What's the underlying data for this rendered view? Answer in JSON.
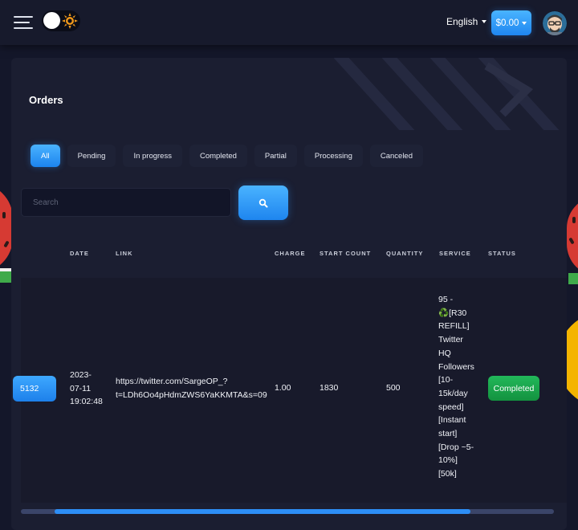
{
  "topbar": {
    "language": "English",
    "balance": "$0.00"
  },
  "page": {
    "title": "Orders"
  },
  "tabs": [
    {
      "label": "All",
      "active": true
    },
    {
      "label": "Pending",
      "active": false
    },
    {
      "label": "In progress",
      "active": false
    },
    {
      "label": "Completed",
      "active": false
    },
    {
      "label": "Partial",
      "active": false
    },
    {
      "label": "Processing",
      "active": false
    },
    {
      "label": "Canceled",
      "active": false
    }
  ],
  "search": {
    "placeholder": "Search",
    "value": ""
  },
  "table": {
    "headers": {
      "date": "DATE",
      "link": "LINK",
      "charge": "CHARGE",
      "start_count": "START COUNT",
      "quantity": "QUANTITY",
      "service": "SERVICE",
      "status": "STATUS"
    },
    "rows": [
      {
        "id": "5132",
        "date_line1": "2023-",
        "date_line2": "07-11",
        "date_line3": "19:02:48",
        "link_line1": "https://twitter.com/SargeOP_?",
        "link_line2": "t=LDh6Oo4pHdmZWS6YaKKMTA&s=09",
        "charge": "1.00",
        "start_count": "1830",
        "quantity": "500",
        "service_lines": [
          "95 -",
          "♻️[R30",
          "REFILL]",
          "Twitter",
          "HQ",
          "Followers",
          "[10-",
          "15k/day",
          "speed]",
          "[Instant",
          "start]",
          "[Drop ~5-",
          "10%]",
          "[50k]"
        ],
        "status": "Completed"
      }
    ]
  },
  "colors": {
    "accent": "#2d8ef5",
    "success": "#1aa64b",
    "background": "#14172a",
    "card": "#1b1e31"
  },
  "icons": {
    "menu": "hamburger-menu-icon",
    "theme": "sun-icon",
    "search": "search-icon",
    "avatar": "avatar"
  }
}
